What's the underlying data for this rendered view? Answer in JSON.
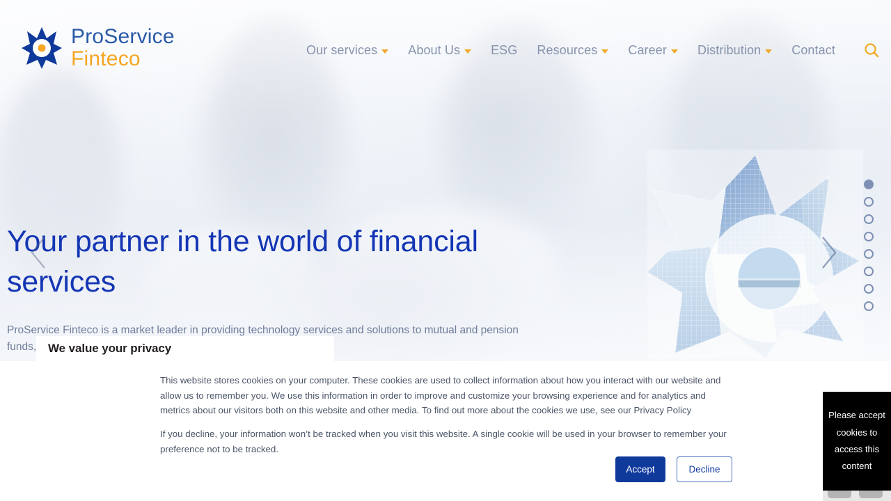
{
  "brand": {
    "name_top": "ProService",
    "name_bottom": "Finteco",
    "logo_icon": "star-burst-logo-icon",
    "color_blue": "#2a5aa8",
    "color_gold": "#f5a623"
  },
  "nav": {
    "items": [
      {
        "label": "Our services",
        "has_dropdown": true
      },
      {
        "label": "About Us",
        "has_dropdown": true
      },
      {
        "label": "ESG",
        "has_dropdown": false
      },
      {
        "label": "Resources",
        "has_dropdown": true
      },
      {
        "label": "Career",
        "has_dropdown": true
      },
      {
        "label": "Distribution",
        "has_dropdown": true
      },
      {
        "label": "Contact",
        "has_dropdown": false
      }
    ],
    "search_icon": "search-icon",
    "language": {
      "flag_icon": "us-flag-icon",
      "caret_icon": "chevron-down-icon"
    }
  },
  "hero": {
    "title": "Your partner in the world of financial services",
    "subtitle": "ProService Finteco is a market leader in providing technology services and solutions to mutual and pension funds, insurance companies and b",
    "prev_icon": "chevron-left-icon",
    "next_icon": "chevron-right-icon",
    "slide_count": 8,
    "active_slide": 1,
    "title_color": "#1436b4",
    "graphic": "star-burst-building-collage"
  },
  "cookie_banner": {
    "title": "We value your privacy",
    "paragraph_1": "This website stores cookies on your computer. These cookies are used to collect information about how you interact with our website and allow us to remember you. We use this information in order to improve and customize your browsing experience and for analytics and metrics about our visitors both on this website and other media. To find out more about the cookies we use, see our Privacy Policy",
    "paragraph_2": "If you decline, your information won’t be tracked when you visit this website. A single cookie will be used in your browser to remember your preference not to be tracked.",
    "accept_label": "Accept",
    "decline_label": "Decline",
    "accept_color": "#10399c"
  },
  "blocked_content": {
    "message": "Please accept cookies to access this content"
  }
}
